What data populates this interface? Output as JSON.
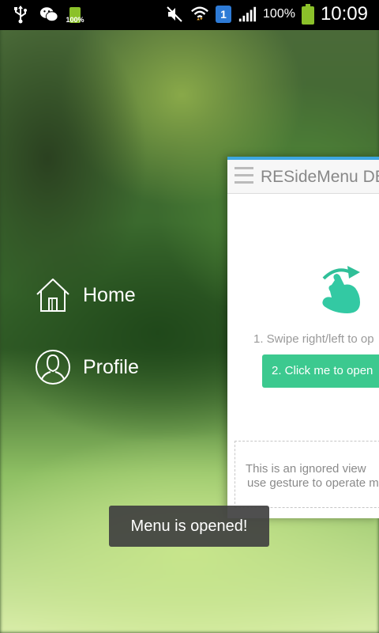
{
  "status_bar": {
    "left_icons": [
      "usb-icon",
      "wechat-icon",
      "battery-charging-icon"
    ],
    "small_battery_label": "100%",
    "sim_slot": "1",
    "battery_percent": "100%",
    "time": "10:09"
  },
  "menu": {
    "items": [
      {
        "label": "Home",
        "icon": "home-icon"
      },
      {
        "label": "Profile",
        "icon": "profile-icon"
      }
    ]
  },
  "content": {
    "title": "RESideMenu DE",
    "gesture_icon": "swipe-hand-icon",
    "step1": "1. Swipe right/left to op",
    "step2_button": "2. Click me to open",
    "ignored_line1": "This is an ignored view",
    "ignored_line2": "use gesture to operate m"
  },
  "toast": {
    "message": "Menu is opened!"
  },
  "colors": {
    "accent_green": "#3cc98f",
    "header_line_blue": "#3da7e0",
    "battery_green": "#8bc12a",
    "sim_blue": "#2e7bd6"
  }
}
